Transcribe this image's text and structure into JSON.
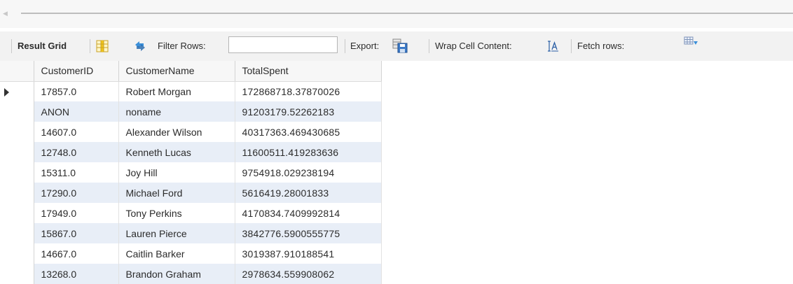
{
  "toolbar": {
    "result_grid_label": "Result Grid",
    "filter_rows_label": "Filter Rows:",
    "filter_value": "",
    "export_label": "Export:",
    "wrap_cell_label": "Wrap Cell Content:",
    "fetch_rows_label": "Fetch rows:"
  },
  "grid": {
    "columns": [
      "CustomerID",
      "CustomerName",
      "TotalSpent"
    ],
    "rows": [
      [
        "17857.0",
        "Robert Morgan",
        "172868718.37870026"
      ],
      [
        "ANON",
        "noname",
        "91203179.52262183"
      ],
      [
        "14607.0",
        "Alexander Wilson",
        "40317363.469430685"
      ],
      [
        "12748.0",
        "Kenneth Lucas",
        "11600511.419283636"
      ],
      [
        "15311.0",
        "Joy Hill",
        "9754918.029238194"
      ],
      [
        "17290.0",
        "Michael Ford",
        "5616419.28001833"
      ],
      [
        "17949.0",
        "Tony Perkins",
        "4170834.7409992814"
      ],
      [
        "15867.0",
        "Lauren Pierce",
        "3842776.5900555775"
      ],
      [
        "14667.0",
        "Caitlin Barker",
        "3019387.910188541"
      ],
      [
        "13268.0",
        "Brandon Graham",
        "2978634.559908062"
      ]
    ],
    "selected_row": 0
  },
  "colors": {
    "toolbar_bg": "#f2f2f2",
    "alt_row": "#e8eef7",
    "grid_border": "#d4d4d4"
  },
  "icons": [
    "form-view-icon",
    "refresh-filter-icon",
    "export-save-icon",
    "wrap-text-icon",
    "fetch-rows-icon"
  ]
}
